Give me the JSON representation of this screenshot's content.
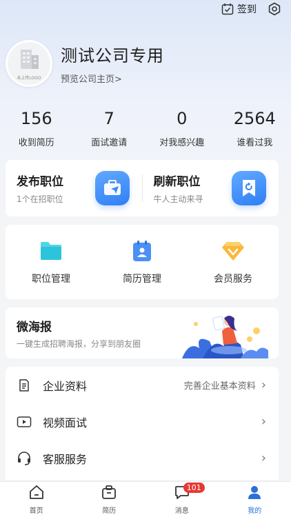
{
  "header": {
    "signin_label": "签到"
  },
  "profile": {
    "logo_caption": "未上传LOGO",
    "company_name": "测试公司专用",
    "homepage_link": "预览公司主页>"
  },
  "stats": [
    {
      "value": "156",
      "label": "收到简历"
    },
    {
      "value": "7",
      "label": "面试邀请"
    },
    {
      "value": "0",
      "label": "对我感兴趣"
    },
    {
      "value": "2564",
      "label": "谁看过我"
    }
  ],
  "publish": {
    "post_title": "发布职位",
    "post_sub": "1个在招职位",
    "refresh_title": "刷新职位",
    "refresh_sub": "牛人主动来寻"
  },
  "tools": [
    {
      "label": "职位管理",
      "icon": "folder-icon"
    },
    {
      "label": "简历管理",
      "icon": "resume-icon"
    },
    {
      "label": "会员服务",
      "icon": "vip-diamond-icon"
    }
  ],
  "poster": {
    "title": "微海报",
    "subtitle": "一键生成招聘海报，分享到朋友圈"
  },
  "menu": [
    {
      "label": "企业资料",
      "hint": "完善企业基本资料",
      "icon": "document-icon"
    },
    {
      "label": "视频面试",
      "hint": "",
      "icon": "video-icon"
    },
    {
      "label": "客服服务",
      "hint": "",
      "icon": "headset-icon"
    }
  ],
  "tabs": [
    {
      "label": "首页",
      "icon": "home-icon"
    },
    {
      "label": "简历",
      "icon": "briefcase-icon"
    },
    {
      "label": "消息",
      "icon": "message-icon",
      "badge": "101"
    },
    {
      "label": "我的",
      "icon": "profile-icon",
      "active": true
    }
  ],
  "colors": {
    "accent": "#2a6fdb",
    "badge": "#e53935"
  }
}
